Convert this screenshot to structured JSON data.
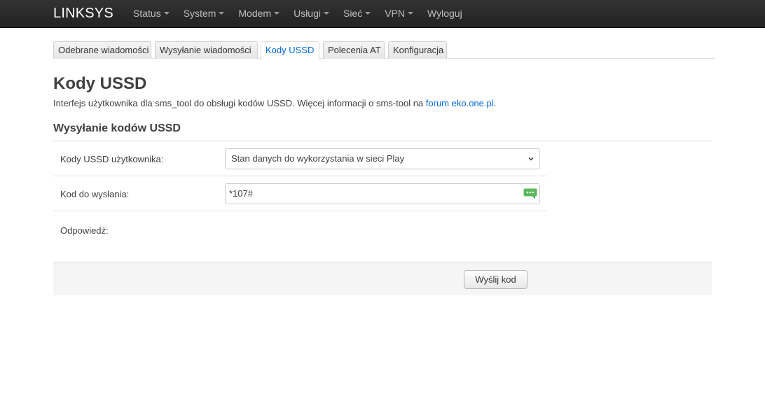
{
  "navbar": {
    "brand": "LINKSYS",
    "items": [
      {
        "label": "Status"
      },
      {
        "label": "System"
      },
      {
        "label": "Modem"
      },
      {
        "label": "Usługi"
      },
      {
        "label": "Sieć"
      },
      {
        "label": "VPN"
      },
      {
        "label": "Wyloguj"
      }
    ]
  },
  "tabs": [
    {
      "label": "Odebrane wiadomości"
    },
    {
      "label": "Wysyłanie wiadomości"
    },
    {
      "label": "Kody USSD",
      "active": true
    },
    {
      "label": "Polecenia AT"
    },
    {
      "label": "Konfiguracja"
    }
  ],
  "page": {
    "title": "Kody USSD",
    "description": "Interfejs użytkownika dla sms_tool do obsługi kodów USSD. Więcej informacji o sms-tool na ",
    "description_link": "forum eko.one.pl",
    "description_end": "."
  },
  "section": {
    "title": "Wysyłanie kodów USSD"
  },
  "form": {
    "user_codes_label": "Kody USSD użytkownika:",
    "user_codes_selected": "Stan danych do wykorzystania w sieci Play",
    "code_label": "Kod do wysłania:",
    "code_value": "*107#",
    "response_label": "Odpowiedź:"
  },
  "actions": {
    "send_label": "Wyślij kod"
  },
  "colors": {
    "navbar_bg": "#222222",
    "link": "#0069d6",
    "chat_icon": "#5cb85c"
  },
  "icons": {
    "dropdown": "caret-down-icon",
    "chat": "chat-bubble-icon"
  }
}
